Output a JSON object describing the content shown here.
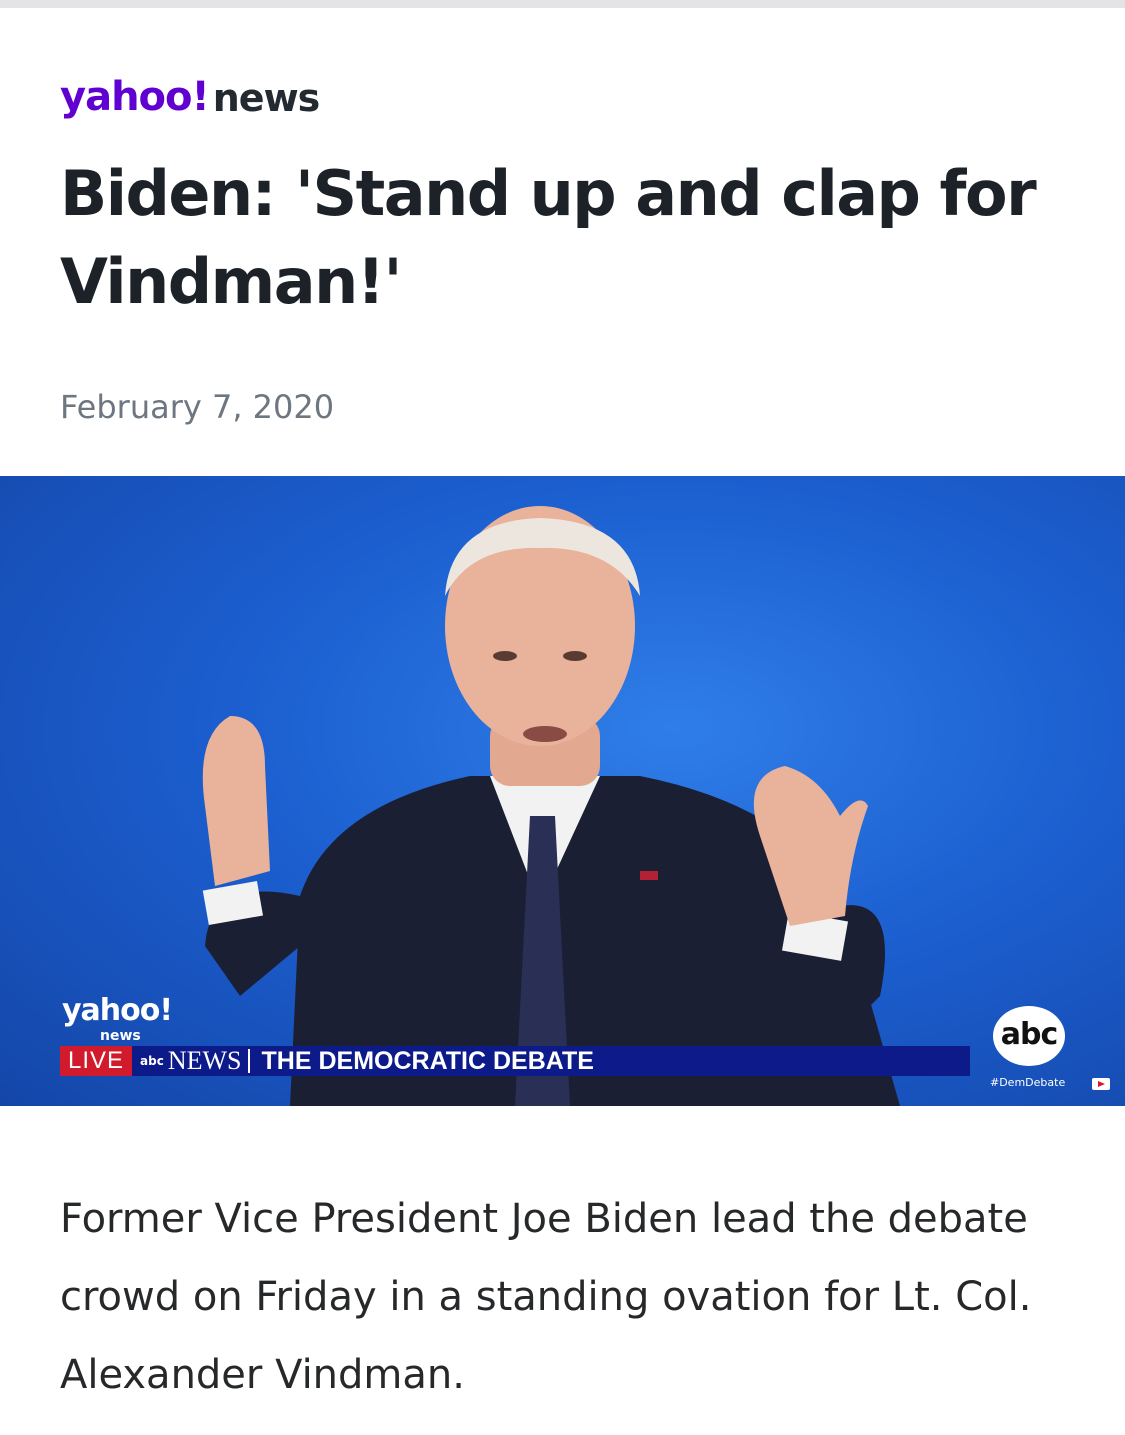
{
  "brand": {
    "yahoo": "yahoo!",
    "news": "news",
    "accent_color": "#6001d2"
  },
  "article": {
    "headline": "Biden: 'Stand up and clap for Vindman!'",
    "date": "February 7, 2020",
    "body": "Former Vice President Joe Biden lead the debate crowd on Friday in a standing ovation for Lt. Col. Alexander Vindman."
  },
  "video": {
    "overlay_yahoo": "yahoo!",
    "overlay_news": "news",
    "live_label": "LIVE",
    "abc_small": "abc",
    "news_label": "NEWS",
    "debate_title": "THE DEMOCRATIC DEBATE",
    "abc_logo": "abc",
    "hashtag": "#DemDebate",
    "bar_color": "#0c1a8a",
    "live_color": "#d11b2c",
    "background_color": "#1c5fd0"
  }
}
